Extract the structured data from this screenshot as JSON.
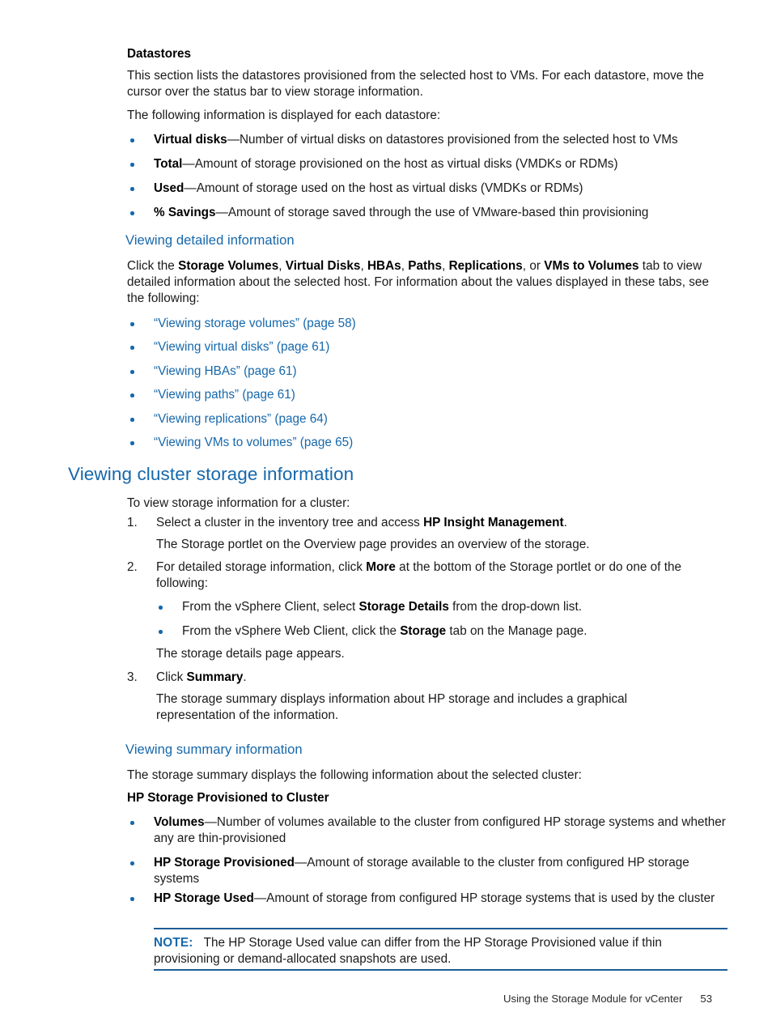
{
  "meta": {
    "page_number": "53",
    "footer_title": "Using the Storage Module for vCenter",
    "accent_blue": "#1668ab",
    "rule_blue": "#1d5d96"
  },
  "datastores": {
    "heading": "Datastores",
    "intro_para": "This section lists the datastores provisioned from the selected host to VMs. For each datastore, move the cursor over the status bar to view storage information.",
    "lead_in": "The following information is displayed for each datastore:",
    "items": [
      {
        "term": "Virtual disks",
        "dash": "—",
        "desc": "Number of virtual disks on datastores provisioned from the selected host to VMs"
      },
      {
        "term": "Total",
        "dash": "—",
        "desc": "Amount of storage provisioned on the host as virtual disks (VMDKs or RDMs)"
      },
      {
        "term": "Used",
        "dash": "—",
        "desc": "Amount of storage used on the host as virtual disks (VMDKs or RDMs)"
      },
      {
        "term": "% Savings",
        "dash": "—",
        "desc": "Amount of storage saved through the use of VMware-based thin provisioning"
      }
    ]
  },
  "viewing_detailed": {
    "heading": "Viewing detailed information",
    "para_prefix": "Click the ",
    "tabs": [
      "Storage Volumes",
      "Virtual Disks",
      "HBAs",
      "Paths",
      "Replications"
    ],
    "tabs_last": "VMs to Volumes",
    "para_middle": " tab to view detailed information about the selected host. For information about the values displayed in these tabs, see the following:",
    "links": [
      "“Viewing storage volumes” (page 58)",
      "“Viewing virtual disks” (page 61)",
      "“Viewing HBAs” (page 61)",
      "“Viewing paths” (page 61)",
      "“Viewing replications” (page 64)",
      "“Viewing VMs to volumes” (page 65)"
    ]
  },
  "cluster_section": {
    "heading": "Viewing cluster storage information",
    "lead_in": "To view storage information for a cluster:",
    "step1": {
      "marker": "1.",
      "text_before": "Select a cluster in the inventory tree and access ",
      "bold": "HP Insight Management",
      "text_after": ".",
      "result": "The Storage portlet on the Overview page provides an overview of the storage."
    },
    "step2": {
      "marker": "2.",
      "text_before": "For detailed storage information, click ",
      "bold": "More",
      "text_after": " at the bottom of the Storage portlet or do one of the following:",
      "sub_bullets": [
        {
          "before": "From the vSphere Client, select ",
          "bold": "Storage Details",
          "after": " from the drop-down list."
        },
        {
          "before": "From the vSphere Web Client, click the ",
          "bold": "Storage",
          "after": " tab on the Manage page."
        }
      ],
      "result": "The storage details page appears."
    },
    "step3": {
      "marker": "3.",
      "text_before": "Click ",
      "bold": "Summary",
      "text_after": ".",
      "result": "The storage summary displays information about HP storage and includes a graphical representation of the information."
    }
  },
  "summary_section": {
    "heading": "Viewing summary information",
    "intro": "The storage summary displays the following information about the selected cluster:",
    "subheading": "HP Storage Provisioned to Cluster",
    "items": [
      {
        "term": "Volumes",
        "dash": "—",
        "desc": "Number of volumes available to the cluster from configured HP storage systems and whether any are thin-provisioned"
      },
      {
        "term": "HP Storage Provisioned",
        "dash": "—",
        "desc": "Amount of storage available to the cluster from configured HP storage systems"
      },
      {
        "term": "HP Storage Used",
        "dash": "—",
        "desc": "Amount of storage from configured HP storage systems that is used by the cluster"
      }
    ],
    "note": {
      "label": "NOTE:",
      "text": "The HP Storage Used value can differ from the HP Storage Provisioned value if thin provisioning or demand-allocated snapshots are used."
    }
  }
}
